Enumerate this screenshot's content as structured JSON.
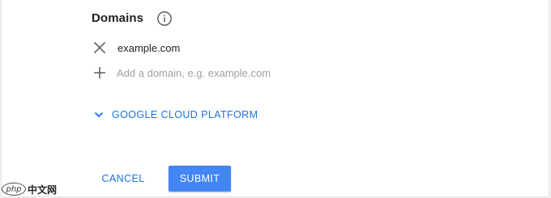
{
  "domains_section": {
    "title": "Domains",
    "info_icon": "info-icon",
    "entries": [
      {
        "value": "example.com",
        "remove_icon": "close-icon"
      }
    ],
    "add_field": {
      "icon": "plus-icon",
      "placeholder": "Add a domain, e.g. example.com",
      "value": ""
    }
  },
  "gcp_expander": {
    "icon": "chevron-down-icon",
    "label": "GOOGLE CLOUD PLATFORM"
  },
  "actions": {
    "cancel_label": "CANCEL",
    "submit_label": "SUBMIT"
  },
  "watermark": {
    "logo_text": "php",
    "site_text": "中文网"
  },
  "colors": {
    "accent": "#1a73e8",
    "submit_bg": "#4285f4",
    "icon": "#5f6368",
    "placeholder": "#9aa0a6"
  }
}
